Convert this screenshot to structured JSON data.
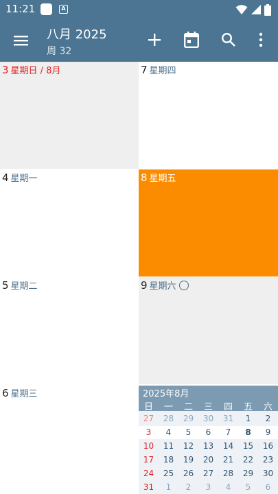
{
  "status": {
    "time": "11:21",
    "notif_icon_letter": "A"
  },
  "appbar": {
    "title": "八月 2025",
    "subtitle": "周 32"
  },
  "colors": {
    "appbar": "#4b7592",
    "selected": "#fb8c00",
    "sunday": "#e02020",
    "shaded": "#efefef"
  },
  "days": [
    {
      "num": "3",
      "dow": "星期日 / 8月",
      "sunday": true
    },
    {
      "num": "4",
      "dow": "星期一"
    },
    {
      "num": "5",
      "dow": "星期二"
    },
    {
      "num": "6",
      "dow": "星期三"
    },
    {
      "num": "7",
      "dow": "星期四"
    },
    {
      "num": "8",
      "dow": "星期五",
      "selected": true
    },
    {
      "num": "9",
      "dow": "星期六"
    }
  ],
  "mini": {
    "title": "2025年8月",
    "weekdays": [
      "日",
      "一",
      "二",
      "三",
      "四",
      "五",
      "六"
    ],
    "weeks": [
      [
        "27",
        "28",
        "29",
        "30",
        "31",
        "1",
        "2"
      ],
      [
        "3",
        "4",
        "5",
        "6",
        "7",
        "8",
        "9"
      ],
      [
        "10",
        "11",
        "12",
        "13",
        "14",
        "15",
        "16"
      ],
      [
        "17",
        "18",
        "19",
        "20",
        "21",
        "22",
        "23"
      ],
      [
        "24",
        "25",
        "26",
        "27",
        "28",
        "29",
        "30"
      ],
      [
        "31",
        "1",
        "2",
        "3",
        "4",
        "5",
        "6"
      ]
    ]
  }
}
